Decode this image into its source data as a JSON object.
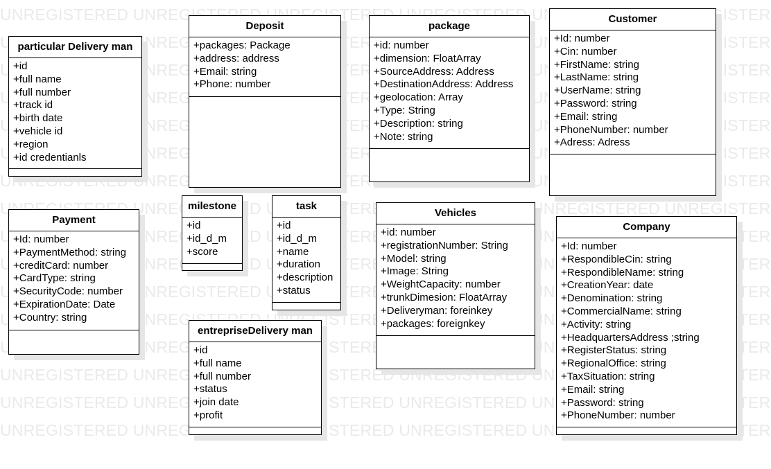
{
  "watermark": {
    "text": "UNREGISTERED"
  },
  "classes": [
    {
      "id": "particular-delivery-man",
      "name": "particular Delivery man",
      "attributes": [
        "+id",
        "+full name",
        "+full number",
        "+track id",
        "+birth date",
        "+vehicle id",
        "+region",
        "+id credentianls"
      ]
    },
    {
      "id": "deposit",
      "name": "Deposit",
      "attributes": [
        "+packages: Package",
        "+address: address",
        "+Email: string",
        "+Phone: number"
      ]
    },
    {
      "id": "package",
      "name": "package",
      "attributes": [
        "+id: number",
        "+dimension: FloatArray",
        "+SourceAddress: Address",
        "+DestinationAddress: Address",
        "+geolocation: Array",
        "+Type: String",
        "+Description: string",
        "+Note: string"
      ]
    },
    {
      "id": "customer",
      "name": "Customer",
      "attributes": [
        "+Id: number",
        "+Cin: number",
        "+FirstName: string",
        "+LastName: string",
        "+UserName: string",
        "+Password: string",
        "+Email: string",
        "+PhoneNumber: number",
        "+Adress: Adress"
      ]
    },
    {
      "id": "payment",
      "name": "Payment",
      "attributes": [
        "+Id: number",
        "+PaymentMethod: string",
        "+creditCard: number",
        "+CardType: string",
        "+SecurityCode: number",
        "+ExpirationDate: Date",
        "+Country: string"
      ]
    },
    {
      "id": "milestone",
      "name": "milestone",
      "attributes": [
        "+id",
        "+id_d_m",
        "+score"
      ]
    },
    {
      "id": "task",
      "name": "task",
      "attributes": [
        "+id",
        "+id_d_m",
        "+name",
        "+duration",
        "+description",
        "+status"
      ]
    },
    {
      "id": "vehicles",
      "name": "Vehicles",
      "attributes": [
        "+id: number",
        "+registrationNumber: String",
        "+Model: string",
        "+Image: String",
        "+WeightCapacity: number",
        "+trunkDimesion: FloatArray",
        "+Deliveryman: foreinkey",
        "+packages: foreignkey"
      ]
    },
    {
      "id": "company",
      "name": "Company",
      "attributes": [
        "+Id: number",
        "+RespondibleCin: string",
        "+RespondibleName: string",
        "+CreationYear: date",
        "+Denomination: string",
        "+CommercialName: string",
        "+Activity: string",
        "+HeadquartersAddress ;string",
        "+RegisterStatus: string",
        "+RegionalOffice: string",
        "+TaxSituation: string",
        "+Email: string",
        "+Password: string",
        "+PhoneNumber: number"
      ]
    },
    {
      "id": "entreprise-delivery-man",
      "name": "entrepriseDelivery man",
      "attributes": [
        "+id",
        "+full name",
        "+full number",
        "+status",
        "+join date",
        "+profit"
      ]
    }
  ]
}
